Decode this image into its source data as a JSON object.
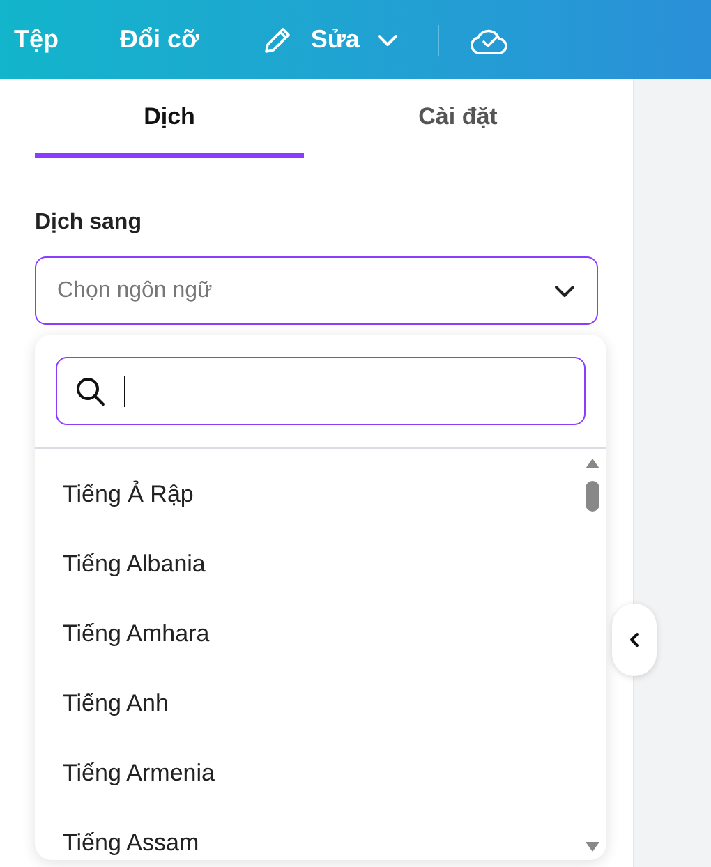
{
  "toolbar": {
    "items": [
      {
        "kind": "text",
        "label": "Tệp"
      },
      {
        "kind": "text",
        "label": "Đổi cỡ"
      },
      {
        "kind": "edit",
        "label": "Sửa"
      },
      {
        "kind": "cloud"
      }
    ]
  },
  "tabs": [
    {
      "label": "Dịch",
      "selected": true
    },
    {
      "label": "Cài đặt",
      "selected": false
    }
  ],
  "target_language": {
    "label": "Dịch sang",
    "placeholder": "Chọn ngôn ngữ",
    "expanded": true
  },
  "language_list": {
    "items": [
      "Tiếng Ả Rập",
      "Tiếng Albania",
      "Tiếng Amhara",
      "Tiếng Anh",
      "Tiếng Armenia",
      "Tiếng Assam"
    ]
  }
}
